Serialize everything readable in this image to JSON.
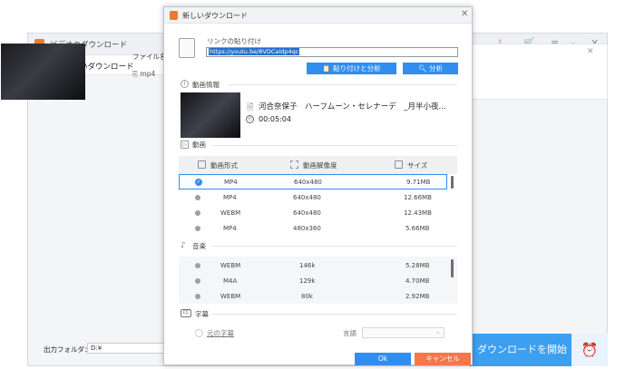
{
  "main_window": {
    "title": "ビデオのダウンロード",
    "new_download": "新しいダウンロード",
    "filename_label": "ファイル名:",
    "format": "mp4",
    "output_folder_label": "出力フォルダ：",
    "output_folder_value": "D:¥",
    "start_download": "ダウンロードを開始"
  },
  "dialog": {
    "title": "新しいダウンロード",
    "paste_link_label": "リンクの貼り付け",
    "url_value": "https://youtu.be/8VDCaldp4qc",
    "paste_and_analyze": "貼り付けと分析",
    "analyze": "分析",
    "video_info_title": "動画情報",
    "video_title": "河合奈保子　ハーフムーン・セレナーデ　_月半小夜...",
    "duration": "00:05:04",
    "video_section_title": "動画",
    "video_columns": [
      "動画形式",
      "動画解像度",
      "サイズ"
    ],
    "video_rows": [
      {
        "format": "MP4",
        "resolution": "640x480",
        "size": "9.71MB",
        "selected": true
      },
      {
        "format": "MP4",
        "resolution": "640x480",
        "size": "12.66MB",
        "selected": false
      },
      {
        "format": "WEBM",
        "resolution": "640x480",
        "size": "12.43MB",
        "selected": false
      },
      {
        "format": "MP4",
        "resolution": "480x360",
        "size": "5.66MB",
        "selected": false
      }
    ],
    "audio_section_title": "音楽",
    "audio_rows": [
      {
        "format": "WEBM",
        "bitrate": "146k",
        "size": "5.28MB"
      },
      {
        "format": "M4A",
        "bitrate": "129k",
        "size": "4.70MB"
      },
      {
        "format": "WEBM",
        "bitrate": "80k",
        "size": "2.92MB"
      }
    ],
    "subtitle_section_title": "字幕",
    "subtitle_icon_text": "CC",
    "original_subtitle": "元の字幕",
    "language_label": "言語",
    "ok": "Ok",
    "cancel": "キャンセル"
  },
  "colors": {
    "accent": "#2f8ef0",
    "cancel": "#f3784a",
    "logo": "#f07a2a"
  }
}
